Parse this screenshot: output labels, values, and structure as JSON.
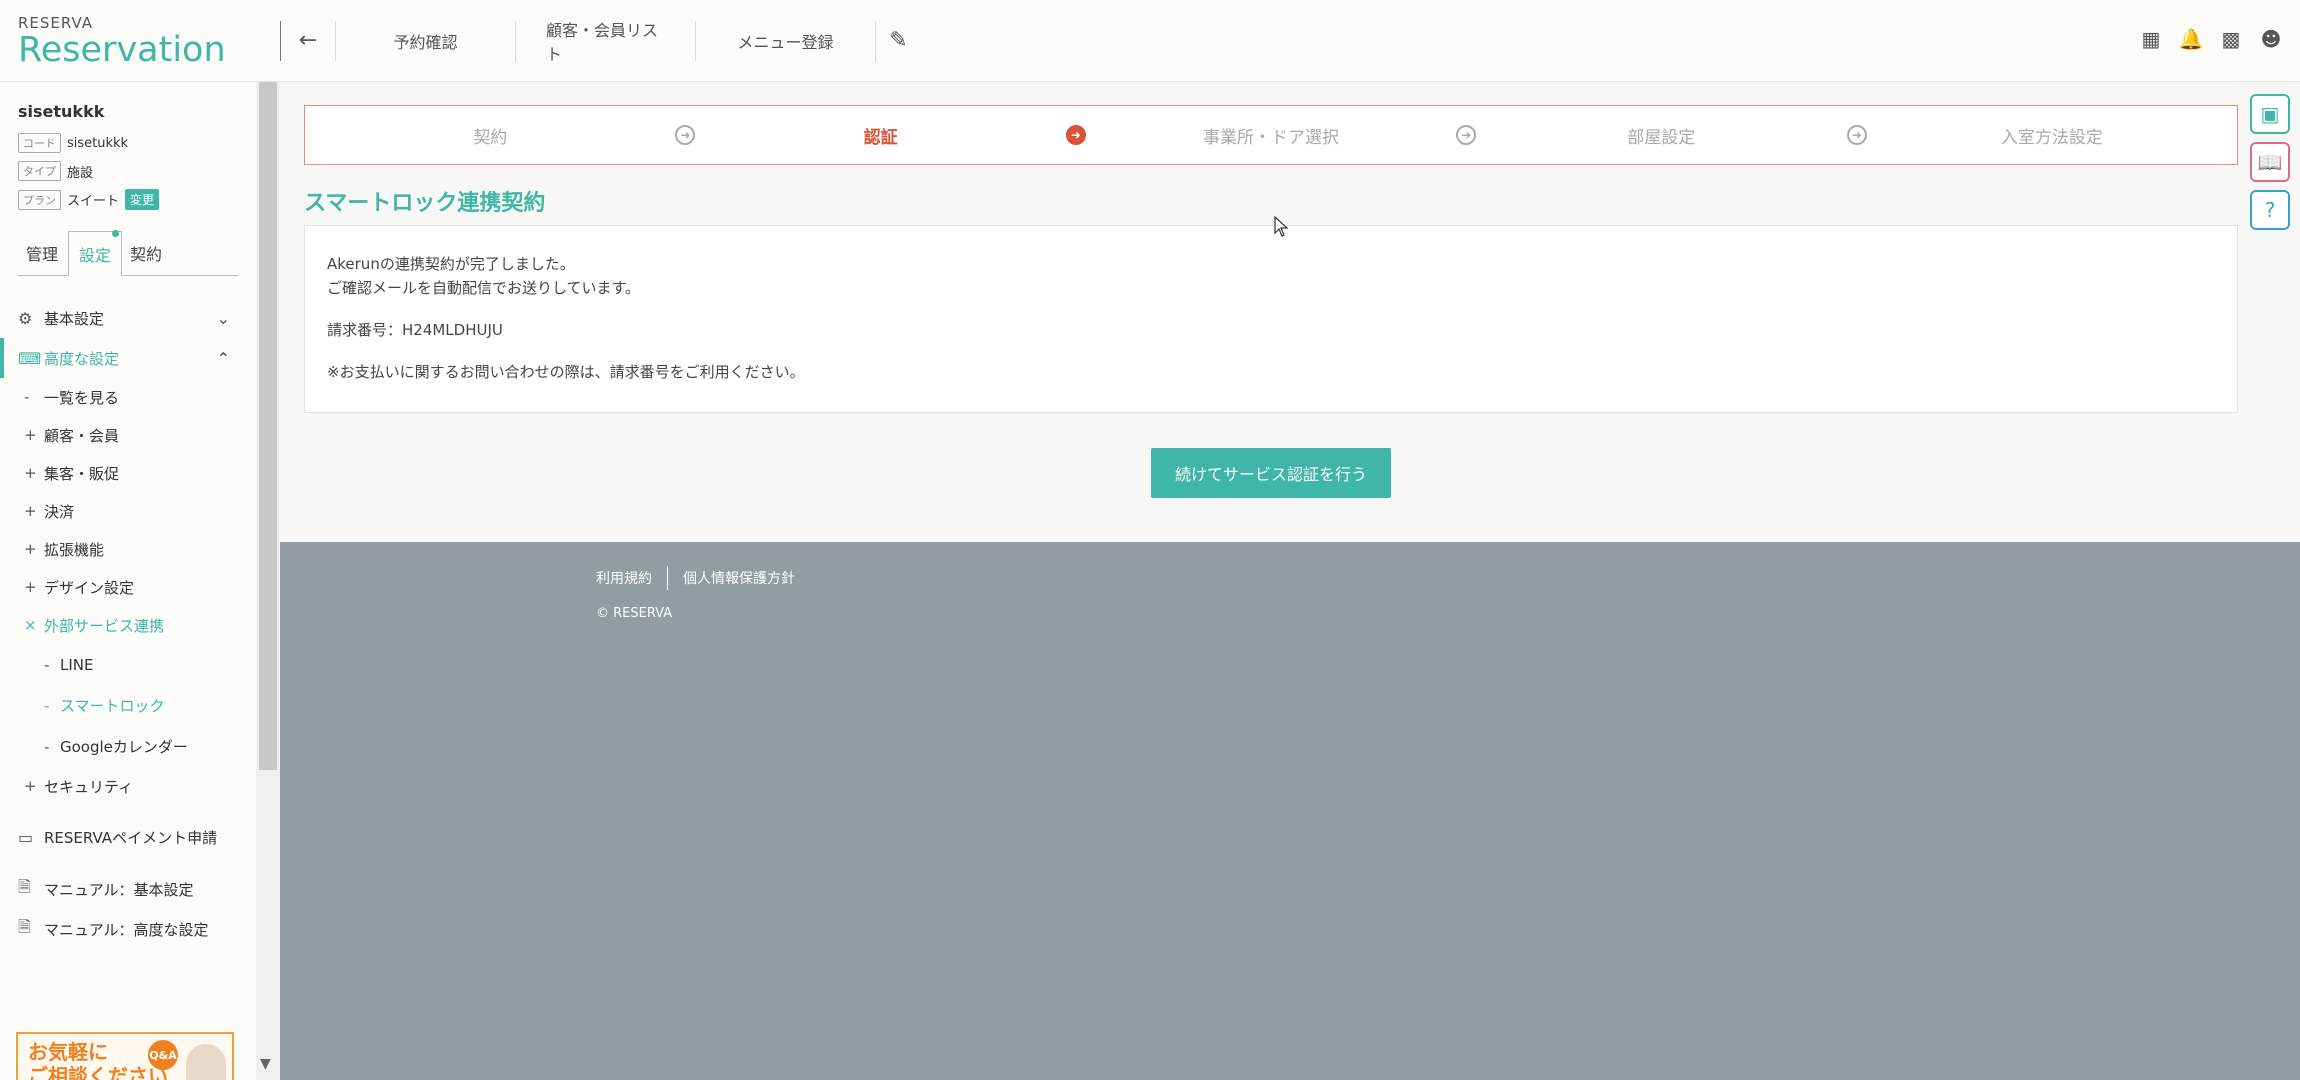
{
  "header": {
    "logo_small": "RESERVA",
    "logo_big": "Reservation",
    "back_icon": "arrow-left-icon",
    "nav": [
      {
        "label": "予約確認"
      },
      {
        "label": "顧客・会員リスト"
      },
      {
        "label": "メニュー登録"
      }
    ],
    "edit_icon": "pencil-square-icon",
    "right_icons": [
      "grid-icon",
      "bell-icon",
      "building-gear-icon",
      "user-circle-icon"
    ]
  },
  "sidebar": {
    "facility_name": "sisetukkk",
    "meta": [
      {
        "tag": "コード",
        "value": "sisetukkk"
      },
      {
        "tag": "タイプ",
        "value": "施設"
      },
      {
        "tag": "プラン",
        "value": "スイート",
        "badge": "変更"
      }
    ],
    "tabs": [
      {
        "label": "管理"
      },
      {
        "label": "設定"
      },
      {
        "label": "契約"
      }
    ],
    "menu": {
      "basic": "基本設定",
      "advanced": "高度な設定",
      "items": [
        {
          "mark": "-",
          "label": "一覧を見る"
        },
        {
          "mark": "+",
          "label": "顧客・会員"
        },
        {
          "mark": "+",
          "label": "集客・販促"
        },
        {
          "mark": "+",
          "label": "決済"
        },
        {
          "mark": "+",
          "label": "拡張機能"
        },
        {
          "mark": "+",
          "label": "デザイン設定"
        },
        {
          "mark": "×",
          "label": "外部サービス連携"
        }
      ],
      "external": [
        {
          "mark": "-",
          "label": "LINE"
        },
        {
          "mark": "-",
          "label": "スマートロック"
        },
        {
          "mark": "-",
          "label": "Googleカレンダー"
        }
      ],
      "security": {
        "mark": "+",
        "label": "セキュリティ"
      },
      "payment_apply": "RESERVAペイメント申請",
      "manual_basic": "マニュアル：基本設定",
      "manual_advanced": "マニュアル：高度な設定"
    },
    "banner": {
      "line1": "お気軽に",
      "line2": "ご相談ください",
      "qa": "Q&A"
    }
  },
  "stepper": {
    "steps": [
      {
        "label": "契約"
      },
      {
        "label": "認証"
      },
      {
        "label": "事業所・ドア選択"
      },
      {
        "label": "部屋設定"
      },
      {
        "label": "入室方法設定"
      }
    ]
  },
  "main": {
    "title": "スマートロック連携契約",
    "message_line1": "Akerunの連携契約が完了しました。",
    "message_line2": "ご確認メールを自動配信でお送りしています。",
    "invoice": "請求番号：H24MLDHUJU",
    "note": "※お支払いに関するお問い合わせの際は、請求番号をご利用ください。",
    "continue_button": "続けてサービス認証を行う"
  },
  "footer": {
    "terms": "利用規約",
    "privacy": "個人情報保護方針",
    "copyright": "© RESERVA"
  },
  "floaters": [
    "browser-window-icon",
    "book-icon",
    "help-headset-icon"
  ]
}
